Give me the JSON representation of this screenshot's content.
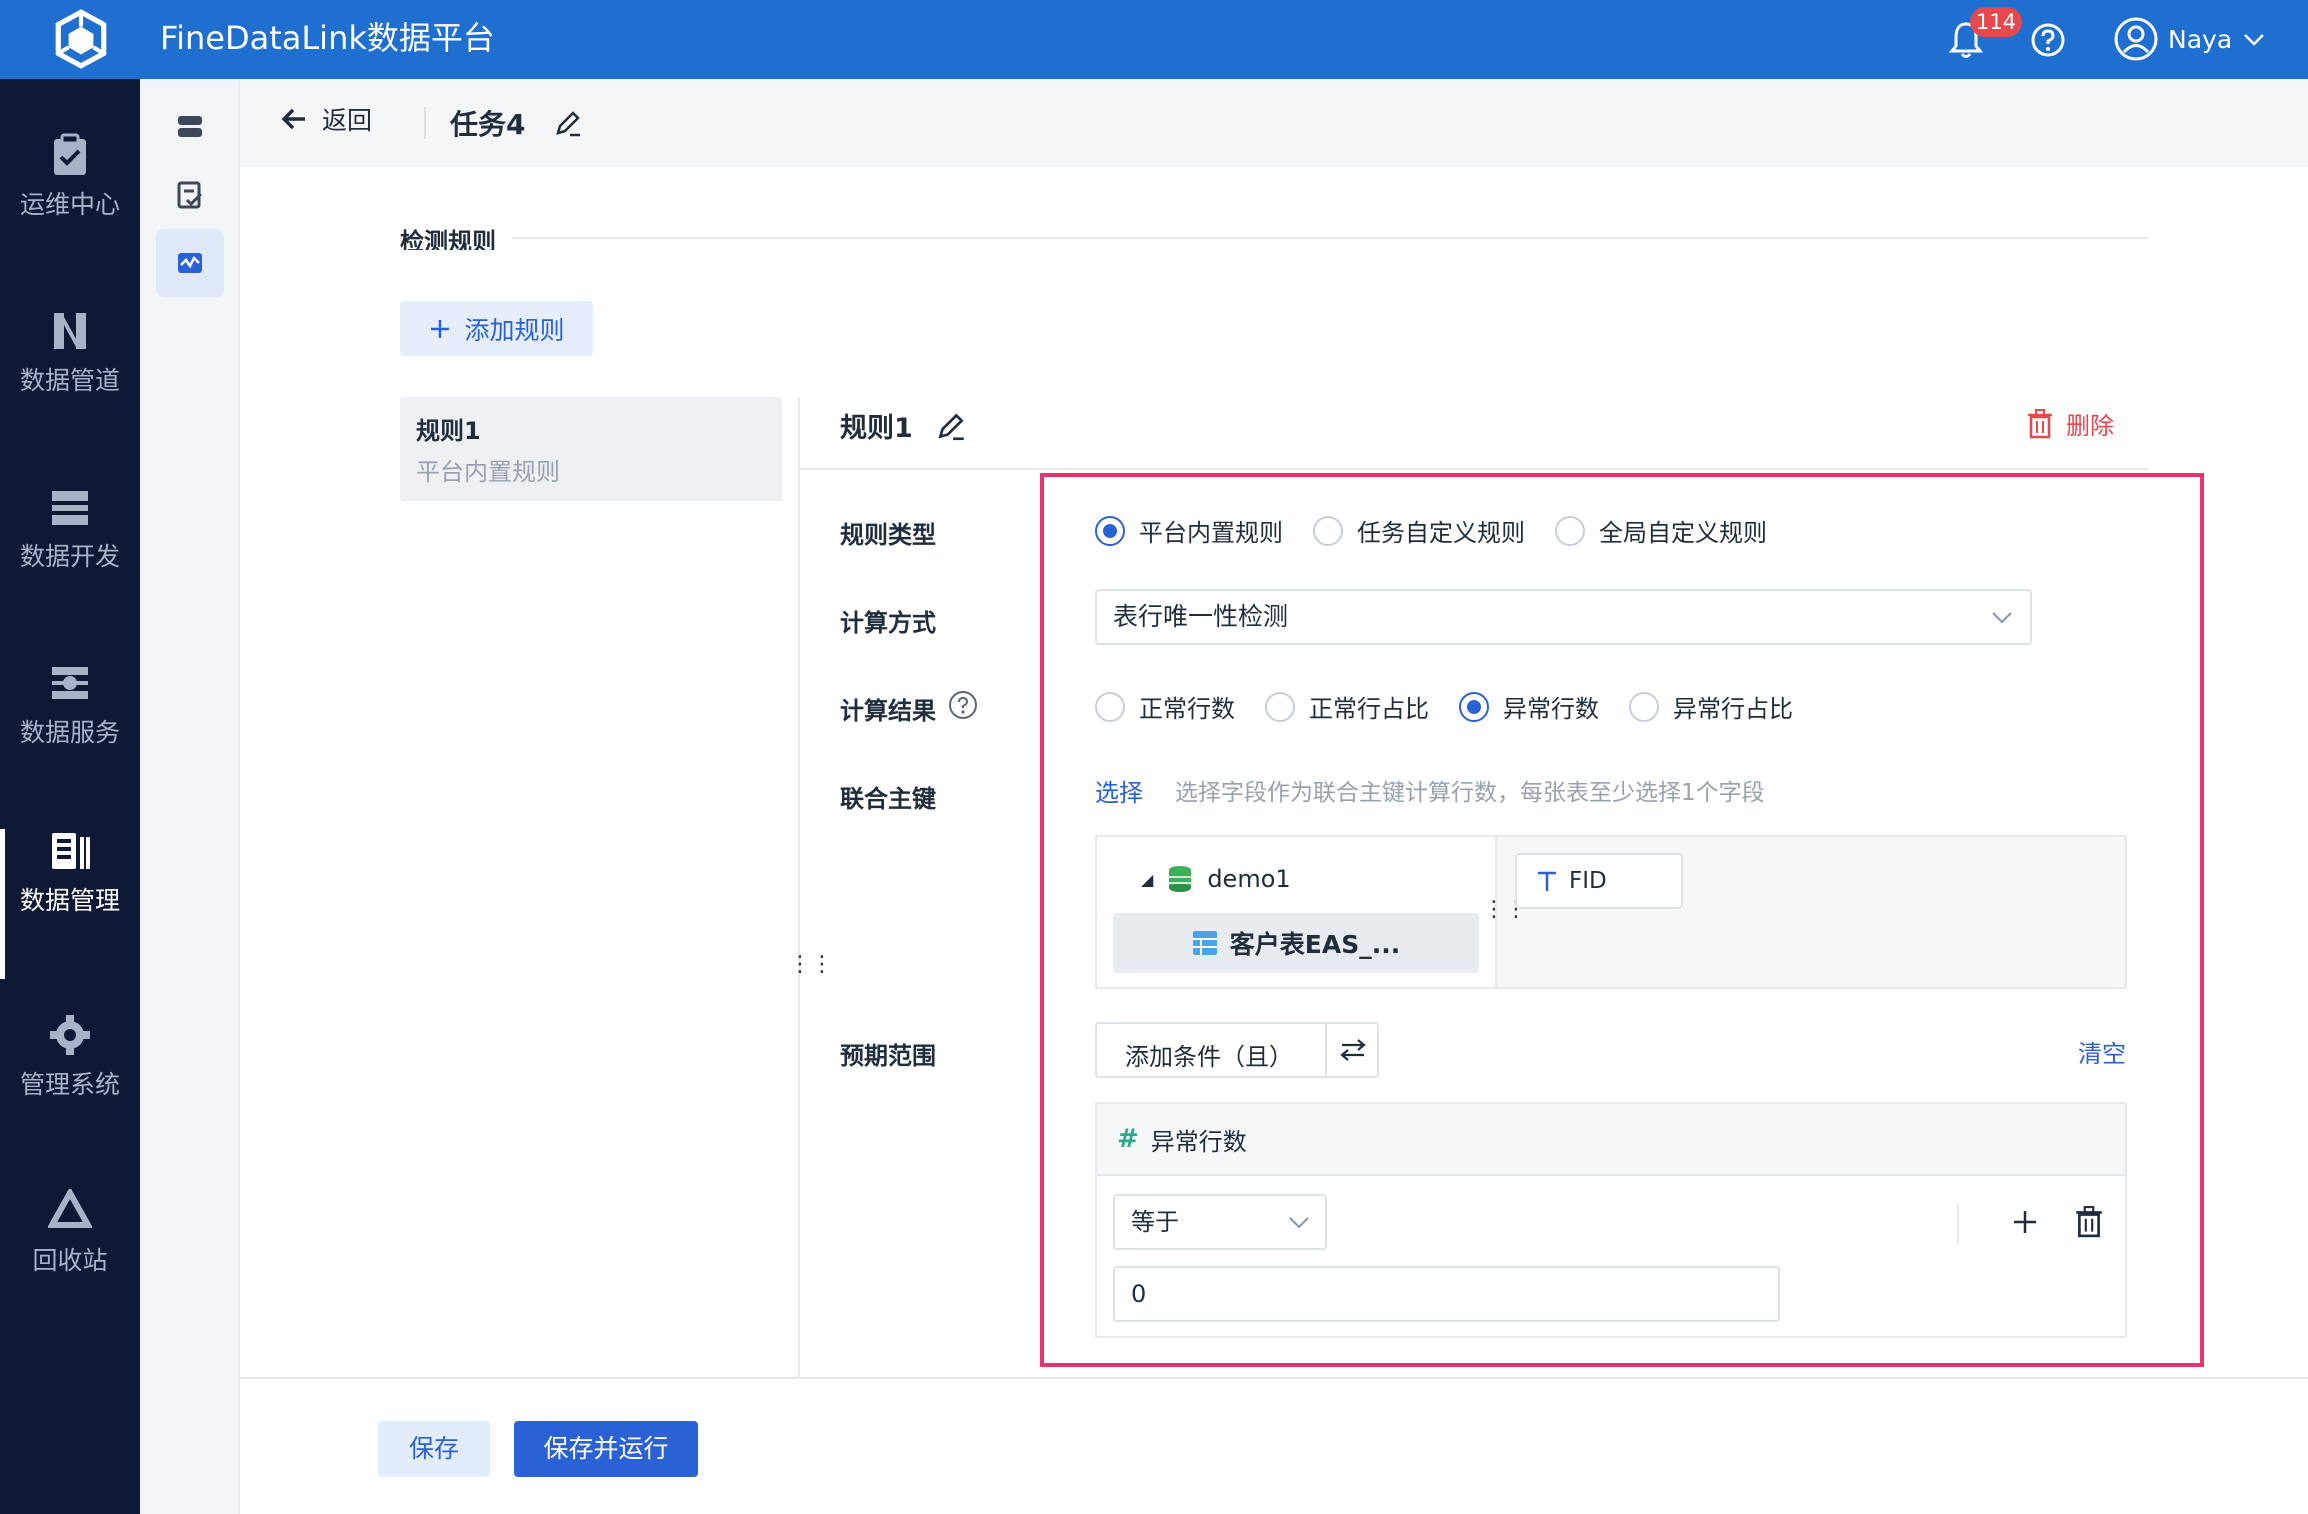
{
  "app": {
    "title": "FineDataLink数据平台",
    "accent": "#1f6fd1",
    "alert_color": "#e5484d"
  },
  "topbar": {
    "notification_count": "114",
    "user_name": "Naya",
    "icons": [
      "logo-icon",
      "bell-icon",
      "help-icon",
      "user-icon",
      "chevron-down-icon"
    ]
  },
  "leftnav": {
    "items": [
      {
        "label": "运维中心",
        "icon": "clipboard-icon",
        "active": false
      },
      {
        "label": "数据管道",
        "icon": "pipeline-icon",
        "active": false
      },
      {
        "label": "数据开发",
        "icon": "dev-icon",
        "active": false
      },
      {
        "label": "数据服务",
        "icon": "service-icon",
        "active": false
      },
      {
        "label": "数据管理",
        "icon": "management-icon",
        "active": true
      },
      {
        "label": "管理系统",
        "icon": "gear-icon",
        "active": false
      },
      {
        "label": "回收站",
        "icon": "recycle-icon",
        "active": false
      }
    ],
    "expand_label": "»"
  },
  "header": {
    "back_label": "返回",
    "task_title": "任务4"
  },
  "section": {
    "title": "检测规则",
    "add_rule_label": "添加规则"
  },
  "rule_list": [
    {
      "title": "规则1",
      "subtitle": "平台内置规则"
    }
  ],
  "rule": {
    "title": "规则1",
    "delete_label": "删除",
    "rule_type": {
      "label": "规则类型",
      "options": [
        "平台内置规则",
        "任务自定义规则",
        "全局自定义规则"
      ],
      "selected": "平台内置规则"
    },
    "calc_method": {
      "label": "计算方式",
      "value": "表行唯一性检测"
    },
    "calc_result": {
      "label": "计算结果",
      "options": [
        "正常行数",
        "正常行占比",
        "异常行数",
        "异常行占比"
      ],
      "selected": "异常行数"
    },
    "union_key": {
      "label": "联合主键",
      "select_link": "选择",
      "hint": "选择字段作为联合主键计算行数，每张表至少选择1个字段",
      "db": "demo1",
      "table": "客户表EAS_...",
      "field": "FID"
    },
    "expected_range": {
      "label": "预期范围",
      "add_condition_label": "添加条件（且）",
      "clear_label": "清空",
      "metric": "异常行数",
      "operator": "等于",
      "value": "0"
    }
  },
  "footer": {
    "save_label": "保存",
    "save_run_label": "保存并运行"
  }
}
